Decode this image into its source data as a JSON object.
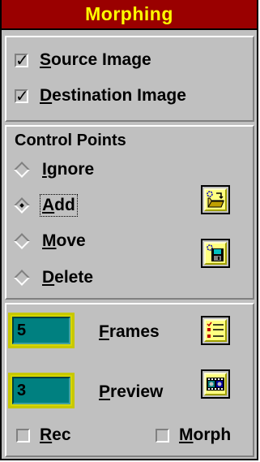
{
  "window": {
    "title": "Morphing"
  },
  "images": {
    "source": {
      "label": "Source Image",
      "mnemonic": "S",
      "rest": "ource Image",
      "checked": true
    },
    "destination": {
      "label": "Destination Image",
      "mnemonic": "D",
      "rest": "estination Image",
      "checked": true
    }
  },
  "control_points": {
    "heading": "Control Points",
    "options": [
      {
        "label": "Ignore",
        "mnemonic": "I",
        "rest": "gnore",
        "selected": false
      },
      {
        "label": "Add",
        "mnemonic": "A",
        "rest": "dd",
        "selected": true
      },
      {
        "label": "Move",
        "mnemonic": "M",
        "rest": "ove",
        "selected": false
      },
      {
        "label": "Delete",
        "mnemonic": "D",
        "rest": "elete",
        "selected": false
      }
    ],
    "open_button": {
      "icon": "open-folder-icon"
    },
    "save_button": {
      "icon": "save-disk-icon"
    }
  },
  "animation": {
    "frames": {
      "value": "5",
      "label": "Frames",
      "mnemonic": "F",
      "rest": "rames"
    },
    "preview": {
      "value": "3",
      "label": "Preview",
      "mnemonic": "P",
      "rest": "review"
    },
    "list_button": {
      "icon": "checklist-icon"
    },
    "preview_button": {
      "icon": "film-preview-icon"
    },
    "rec": {
      "label": "Rec",
      "mnemonic": "R",
      "rest": "ec",
      "checked": false
    },
    "morph": {
      "label": "Morph",
      "mnemonic": "M",
      "rest": "orph",
      "checked": false
    }
  },
  "colors": {
    "title_bg": "#9a0000",
    "title_text": "#ffff00",
    "panel_bg": "#c0c0c0",
    "field_bg": "#008080",
    "button_face": "#ffff80"
  }
}
